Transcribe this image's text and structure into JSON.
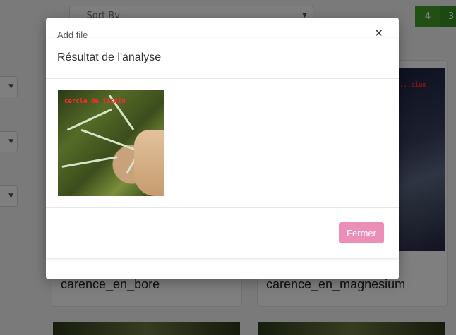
{
  "background": {
    "sort_placeholder": "-- Sort By --",
    "pagination": [
      "4",
      "3"
    ],
    "cards": [
      {
        "title": "carence_en_bore"
      },
      {
        "title": "carence_en_magnesium"
      }
    ],
    "image_label": "...dium"
  },
  "outer_modal": {
    "title": "Add file"
  },
  "result_modal": {
    "title": "Résultat de l'analyse",
    "image_label": "cercle_de_jasmin",
    "close_label": "Fermer"
  },
  "colors": {
    "primary_green": "#44a028",
    "close_pink": "#ec8fb6",
    "card_btn_green": "#7fb85f",
    "card_btn_pink": "#ec8fb6"
  },
  "icons": {
    "close": "close-icon",
    "caret": "chevron-down-icon"
  }
}
